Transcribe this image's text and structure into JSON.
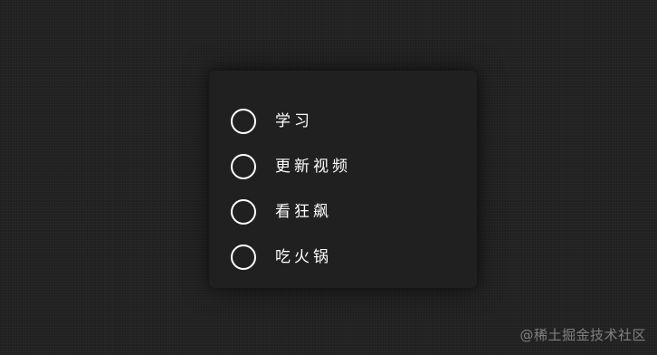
{
  "todo": {
    "items": [
      {
        "label": "学习",
        "checked": false
      },
      {
        "label": "更新视频",
        "checked": false
      },
      {
        "label": "看狂飙",
        "checked": false
      },
      {
        "label": "吃火锅",
        "checked": false
      }
    ]
  },
  "watermark": {
    "text": "@稀土掘金技术社区"
  },
  "colors": {
    "background": "#232323",
    "card": "#202020",
    "text": "#ffffff"
  },
  "icons": {
    "checkbox": "circle-outline"
  }
}
